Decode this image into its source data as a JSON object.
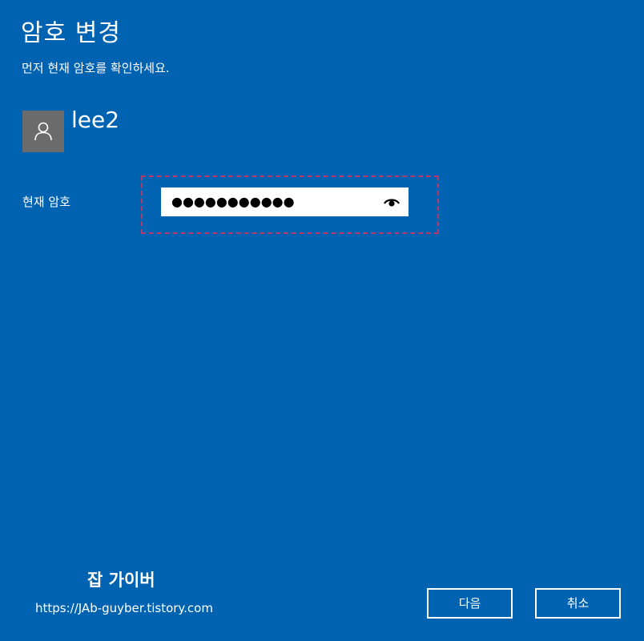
{
  "dialog": {
    "title": "암호 변경",
    "subtitle": "먼저 현재 암호를 확인하세요."
  },
  "user": {
    "name": "lee2",
    "avatar_icon": "person-icon"
  },
  "current_password": {
    "label": "현재 암호",
    "masked_value": "●●●●●●●●●●●",
    "reveal_icon": "eye-icon"
  },
  "watermark": {
    "title": "잡 가이버",
    "url": "https://JAb-guyber.tistory.com"
  },
  "buttons": {
    "next_label": "다음",
    "cancel_label": "취소"
  },
  "colors": {
    "background": "#0063b1",
    "avatar": "#6b6b6b",
    "highlight": "#b5396a"
  }
}
